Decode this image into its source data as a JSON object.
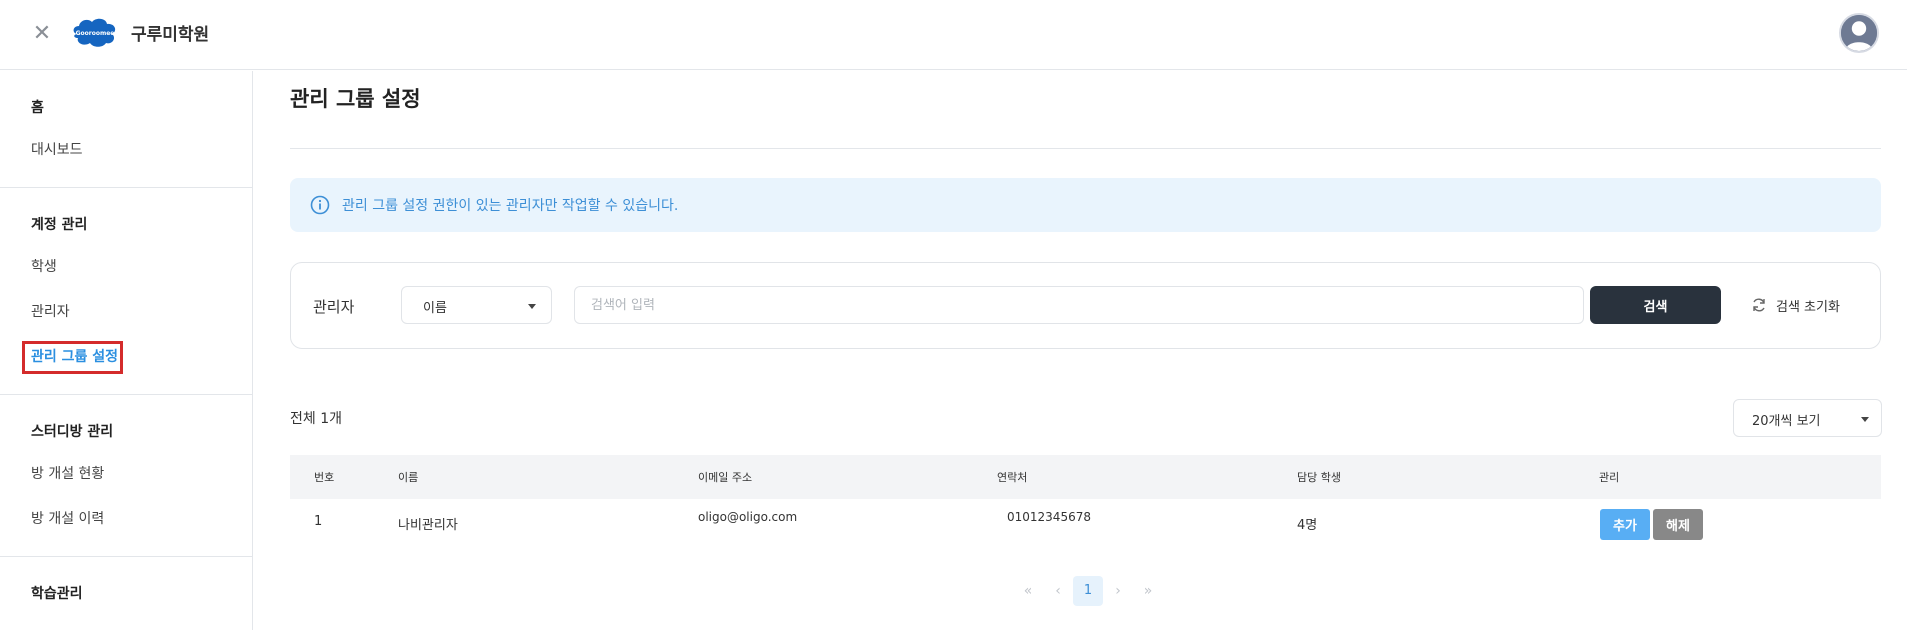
{
  "header": {
    "brand_logo_text": "Gooroomee",
    "brand_name": "구루미학원"
  },
  "sidebar": {
    "sections": [
      {
        "heading": "홈",
        "items": [
          {
            "label": "대시보드"
          }
        ]
      },
      {
        "heading": "계정 관리",
        "items": [
          {
            "label": "학생"
          },
          {
            "label": "관리자"
          },
          {
            "label": "관리 그룹 설정",
            "active": true
          }
        ]
      },
      {
        "heading": "스터디방 관리",
        "items": [
          {
            "label": "방 개설 현황"
          },
          {
            "label": "방 개설 이력"
          }
        ]
      },
      {
        "heading": "학습관리",
        "items": []
      }
    ]
  },
  "main": {
    "title": "관리 그룹 설정",
    "info_text": "관리 그룹 설정 권한이 있는 관리자만 작업할 수 있습니다.",
    "search": {
      "label": "관리자",
      "type_selected": "이름",
      "placeholder": "검색어 입력",
      "search_button": "검색",
      "reset_button": "검색 초기화"
    },
    "total_count": "전체 1개",
    "page_size_selected": "20개씩 보기",
    "table": {
      "headers": [
        "번호",
        "이름",
        "이메일 주소",
        "연락처",
        "담당 학생",
        "관리"
      ],
      "rows": [
        {
          "no": "1",
          "name": "나비관리자",
          "email": "oligo@oligo.com",
          "phone": "01012345678",
          "students": "4명",
          "add_label": "추가",
          "remove_label": "해제"
        }
      ]
    },
    "pagination": {
      "first": "«",
      "prev": "‹",
      "current": "1",
      "next": "›",
      "last": "»"
    }
  },
  "colors": {
    "accent": "#2b8fe0",
    "highlight_box": "#d42b2b",
    "search_button": "#29323d",
    "add_button": "#58aef4",
    "remove_button": "#888888",
    "info_bg": "#e9f4fd"
  }
}
